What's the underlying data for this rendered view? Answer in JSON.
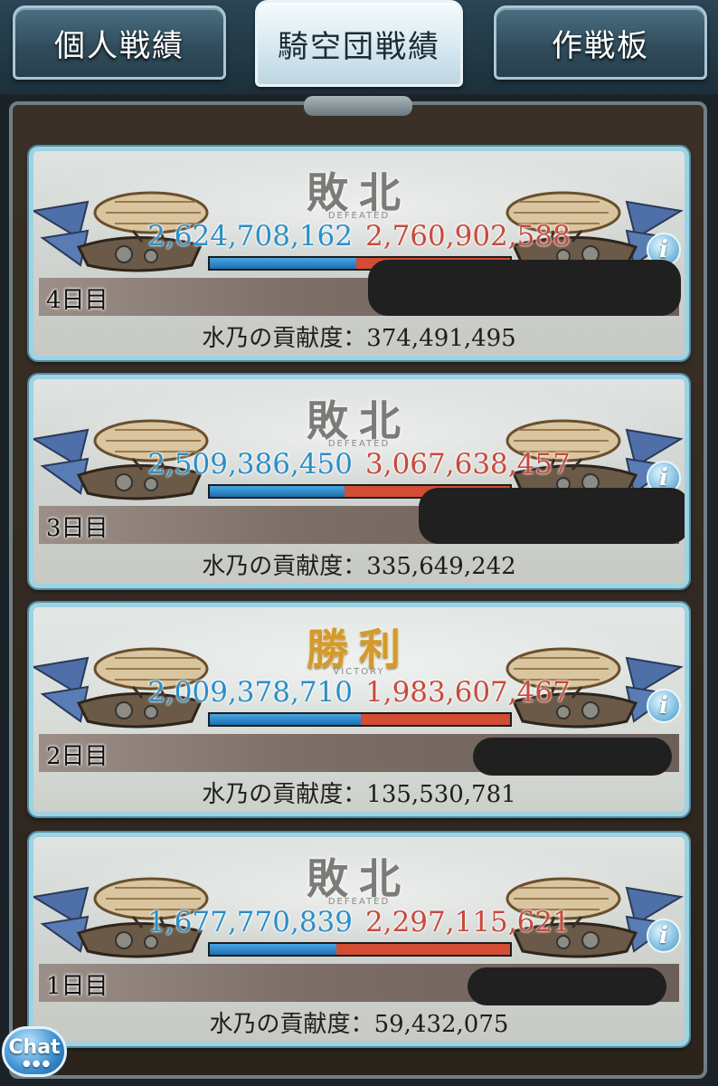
{
  "tabs": [
    {
      "label": "個人戦績",
      "active": false
    },
    {
      "label": "騎空団戦績",
      "active": true
    },
    {
      "label": "作戦板",
      "active": false
    }
  ],
  "results": [
    {
      "result": "敗北",
      "result_sub": "DEFEATED",
      "victory": false,
      "ally_score": "2,624,708,162",
      "enemy_score": "2,760,902,588",
      "ally_ratio": 0.487,
      "day": "4日目",
      "contrib_label": "水乃の貢献度：",
      "contrib_value": "374,491,495"
    },
    {
      "result": "敗北",
      "result_sub": "DEFEATED",
      "victory": false,
      "ally_score": "2,509,386,450",
      "enemy_score": "3,067,638,457",
      "ally_ratio": 0.45,
      "day": "3日目",
      "contrib_label": "水乃の貢献度：",
      "contrib_value": "335,649,242"
    },
    {
      "result": "勝利",
      "result_sub": "VICTORY",
      "victory": true,
      "ally_score": "2,009,378,710",
      "enemy_score": "1,983,607,467",
      "ally_ratio": 0.503,
      "day": "2日目",
      "contrib_label": "水乃の貢献度：",
      "contrib_value": "135,530,781"
    },
    {
      "result": "敗北",
      "result_sub": "DEFEATED",
      "victory": false,
      "ally_score": "1,677,770,839",
      "enemy_score": "2,297,115,621",
      "ally_ratio": 0.422,
      "day": "1日目",
      "contrib_label": "水乃の貢献度：",
      "contrib_value": "59,432,075"
    }
  ],
  "chat": {
    "label": "Chat",
    "icon": "chat-bubble-icon"
  },
  "icons": {
    "info": "info-icon",
    "ship": "airship-icon"
  },
  "colors": {
    "ally": "#2b8fc7",
    "enemy": "#c74a3c",
    "victory": "#d39a2c",
    "defeat": "#7b7b78",
    "card_border": "#9fd2e3"
  }
}
